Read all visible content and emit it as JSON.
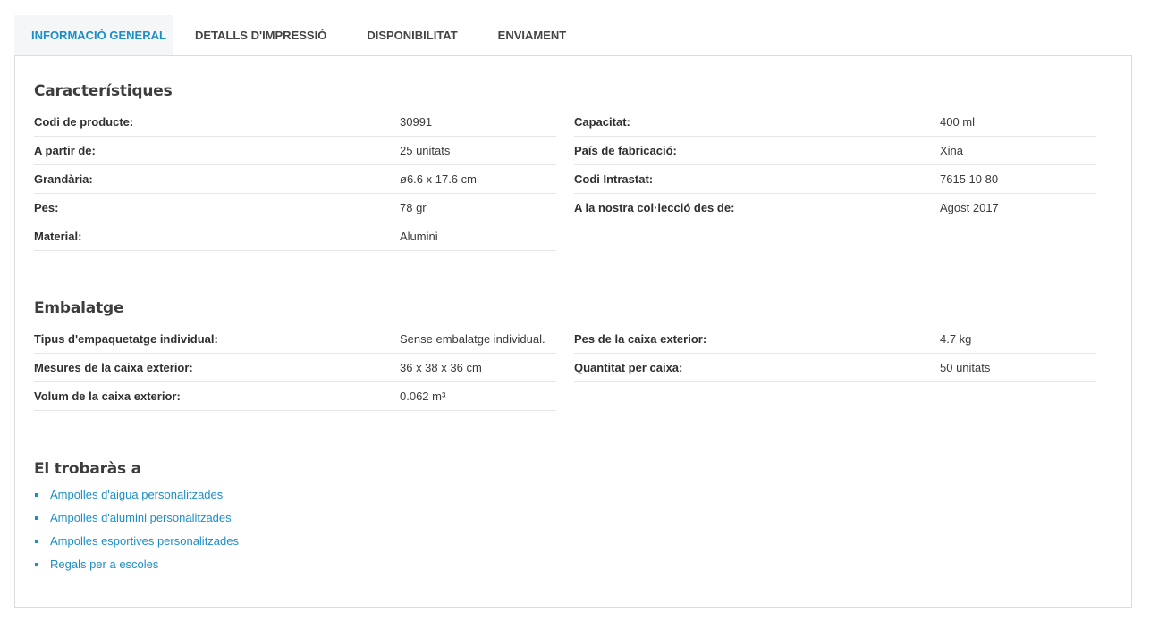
{
  "tabs": [
    {
      "label": "INFORMACIÓ GENERAL",
      "active": true
    },
    {
      "label": "DETALLS D'IMPRESSIÓ",
      "active": false
    },
    {
      "label": "DISPONIBILITAT",
      "active": false
    },
    {
      "label": "ENVIAMENT",
      "active": false
    }
  ],
  "characteristics": {
    "title": "Característiques",
    "left": [
      {
        "label": "Codi de producte:",
        "value": "30991"
      },
      {
        "label": "A partir de:",
        "value": "25 unitats"
      },
      {
        "label": "Grandària:",
        "value": "ø6.6 x 17.6 cm"
      },
      {
        "label": "Pes:",
        "value": "78 gr"
      },
      {
        "label": "Material:",
        "value": "Alumini"
      }
    ],
    "right": [
      {
        "label": "Capacitat:",
        "value": "400 ml"
      },
      {
        "label": "País de fabricació:",
        "value": "Xina"
      },
      {
        "label": "Codi Intrastat:",
        "value": "7615 10 80"
      },
      {
        "label": "A la nostra col·lecció des de:",
        "value": "Agost 2017"
      }
    ]
  },
  "packaging": {
    "title": "Embalatge",
    "left": [
      {
        "label": "Tipus d'empaquetatge individual:",
        "value": "Sense embalatge individual."
      },
      {
        "label": "Mesures de la caixa exterior:",
        "value": "36 x 38 x 36 cm"
      },
      {
        "label": "Volum de la caixa exterior:",
        "value": "0.062 m³"
      }
    ],
    "right": [
      {
        "label": "Pes de la caixa exterior:",
        "value": "4.7 kg"
      },
      {
        "label": "Quantitat per caixa:",
        "value": "50 unitats"
      }
    ]
  },
  "found_in": {
    "title": "El trobaràs a",
    "links": [
      "Ampolles d'aigua personalitzades",
      "Ampolles d'alumini personalitzades",
      "Ampolles esportives personalitzades",
      "Regals per a escoles"
    ]
  },
  "colors": {
    "accent": "#1b8ec8",
    "active_tab_bg": "#f4f6f8",
    "border": "#dcdcdc"
  }
}
